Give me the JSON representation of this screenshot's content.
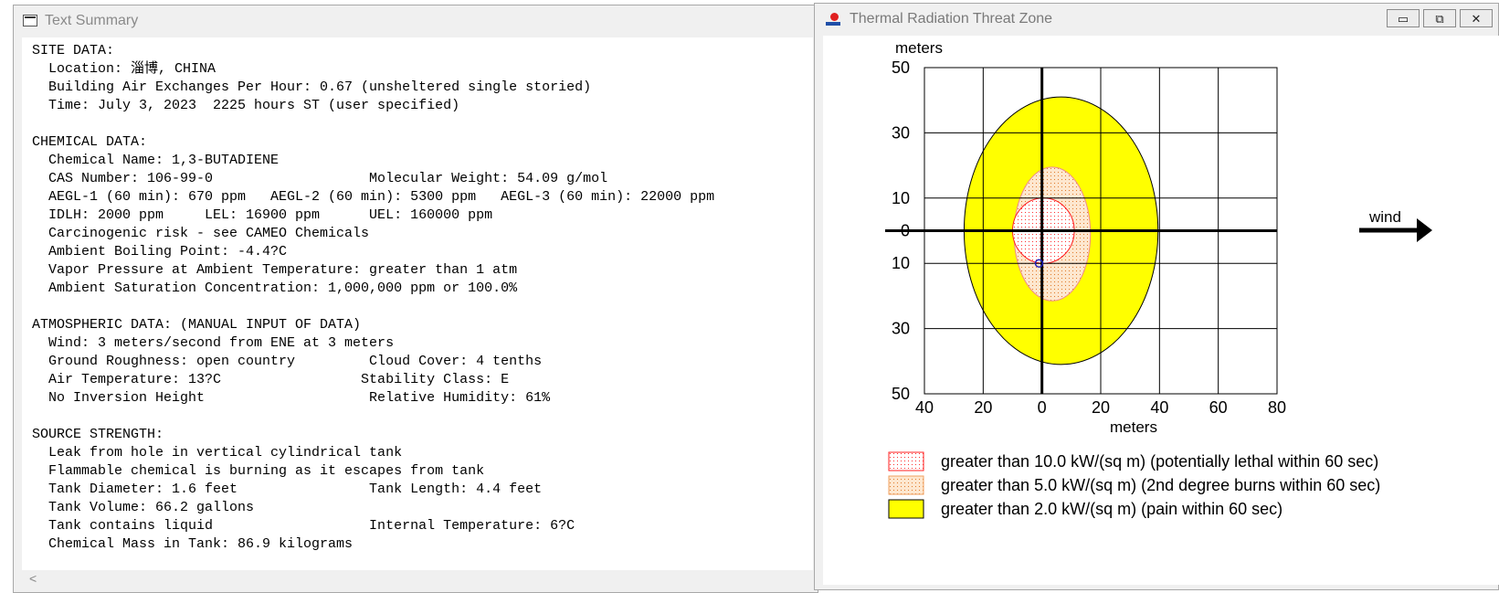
{
  "text_summary": {
    "title": "Text Summary",
    "lines": [
      "SITE DATA:",
      "  Location: 淄博, CHINA",
      "  Building Air Exchanges Per Hour: 0.67 (unsheltered single storied)",
      "  Time: July 3, 2023  2225 hours ST (user specified)",
      "",
      "CHEMICAL DATA:",
      "  Chemical Name: 1,3-BUTADIENE",
      "  CAS Number: 106-99-0                   Molecular Weight: 54.09 g/mol",
      "  AEGL-1 (60 min): 670 ppm   AEGL-2 (60 min): 5300 ppm   AEGL-3 (60 min): 22000 ppm",
      "  IDLH: 2000 ppm     LEL: 16900 ppm      UEL: 160000 ppm",
      "  Carcinogenic risk - see CAMEO Chemicals",
      "  Ambient Boiling Point: -4.4?C",
      "  Vapor Pressure at Ambient Temperature: greater than 1 atm",
      "  Ambient Saturation Concentration: 1,000,000 ppm or 100.0%",
      "",
      "ATMOSPHERIC DATA: (MANUAL INPUT OF DATA)",
      "  Wind: 3 meters/second from ENE at 3 meters",
      "  Ground Roughness: open country         Cloud Cover: 4 tenths",
      "  Air Temperature: 13?C                 Stability Class: E",
      "  No Inversion Height                    Relative Humidity: 61%",
      "",
      "SOURCE STRENGTH:",
      "  Leak from hole in vertical cylindrical tank",
      "  Flammable chemical is burning as it escapes from tank",
      "  Tank Diameter: 1.6 feet                Tank Length: 4.4 feet",
      "  Tank Volume: 66.2 gallons",
      "  Tank contains liquid                   Internal Temperature: 6?C",
      "  Chemical Mass in Tank: 86.9 kilograms"
    ],
    "scroll_left": "<"
  },
  "threat_zone": {
    "title": "Thermal Radiation Threat Zone",
    "buttons": {
      "minimize": "▭",
      "maximize": "⧉",
      "close": "✕"
    },
    "wind_label": "wind",
    "colors": {
      "red_zone": "#ff3030",
      "orange_zone": "#fbd9b5",
      "yellow_zone": "#ffff00"
    },
    "chart_data": {
      "type": "map",
      "x_axis_label": "meters",
      "y_axis_label": "meters",
      "x_range": [
        -40,
        80
      ],
      "y_range": [
        -50,
        50
      ],
      "x_ticks": [
        "40",
        "20",
        "0",
        "20",
        "40",
        "60",
        "80"
      ],
      "y_ticks": [
        "50",
        "30",
        "10",
        "0",
        "10",
        "30",
        "50"
      ],
      "zones": [
        {
          "label": "greater than 2.0 kW/(sq m) (pain within 60 sec)",
          "color": "#ffff00",
          "pattern": "solid",
          "center_x": 6.5,
          "center_y": 0,
          "radius_x": 33,
          "radius_y": 41
        },
        {
          "label": "greater than 5.0 kW/(sq m) (2nd degree burns within 60 sec)",
          "color": "#fbd9b5",
          "pattern": "dotted",
          "center_x": 3.5,
          "center_y": -1,
          "radius_x": 13,
          "radius_y": 20.5
        },
        {
          "label": "greater than 10.0 kW/(sq m) (potentially lethal within 60 sec)",
          "color": "#ff3030",
          "pattern": "dotted-red",
          "center_x": 0.5,
          "center_y": 0,
          "radius_x": 10.5,
          "radius_y": 10
        }
      ],
      "legend": [
        {
          "label": "greater than 10.0 kW/(sq m) (potentially lethal within 60 sec)",
          "swatch": "red-dotted"
        },
        {
          "label": "greater than 5.0 kW/(sq m) (2nd degree burns within 60 sec)",
          "swatch": "orange-dotted"
        },
        {
          "label": "greater than 2.0 kW/(sq m) (pain within 60 sec)",
          "swatch": "yellow-solid"
        }
      ],
      "source_point": {
        "x": -1,
        "y": -10
      }
    }
  }
}
